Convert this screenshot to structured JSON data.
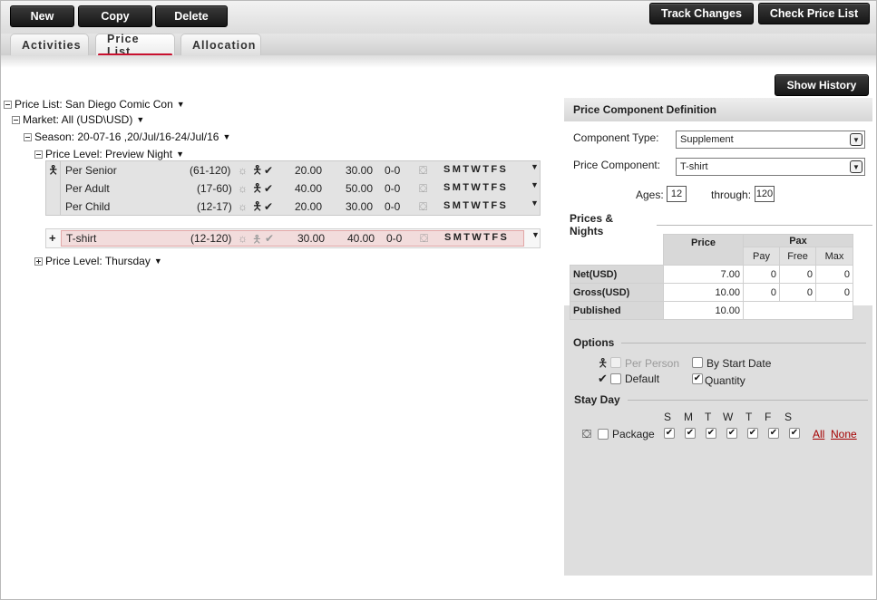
{
  "toolbar": {
    "new_label": "New",
    "copy_label": "Copy",
    "delete_label": "Delete",
    "track_changes_label": "Track Changes",
    "check_price_list_label": "Check Price List"
  },
  "tabs": [
    {
      "label": "Activities"
    },
    {
      "label": "Price List",
      "active": true
    },
    {
      "label": "Allocation"
    }
  ],
  "tree": {
    "price_list": "Price List: San Diego Comic Con",
    "market": "Market: All (USD\\USD)",
    "season": "Season: 20-07-16 ,20/Jul/16-24/Jul/16",
    "level1": "Price Level: Preview Night",
    "level2": "Price Level: Thursday",
    "rows": [
      {
        "name": "Per Senior",
        "ages": "(61-120)",
        "net": "20.00",
        "gross": "30.00",
        "range": "0-0",
        "days": "SMTWTFS"
      },
      {
        "name": "Per Adult",
        "ages": "(17-60)",
        "net": "40.00",
        "gross": "50.00",
        "range": "0-0",
        "days": "SMTWTFS"
      },
      {
        "name": "Per Child",
        "ages": "(12-17)",
        "net": "20.00",
        "gross": "30.00",
        "range": "0-0",
        "days": "SMTWTFS"
      }
    ],
    "supplement": {
      "expander": "+",
      "name": "T-shirt",
      "ages": "(12-120)",
      "net": "30.00",
      "gross": "40.00",
      "range": "0-0",
      "days": "SMTWTFS"
    }
  },
  "show_history_label": "Show History",
  "panel": {
    "title": "Price Component Definition",
    "component_type_label": "Component Type:",
    "component_type_value": "Supplement",
    "price_component_label": "Price Component:",
    "price_component_value": "T-shirt",
    "ages_label": "Ages:",
    "ages_from": "12",
    "through_label": "through:",
    "ages_to": "120",
    "prices_nights_title": "Prices & Nights",
    "table": {
      "price_header": "Price",
      "pax_header": "Pax",
      "pay_header": "Pay",
      "free_header": "Free",
      "max_header": "Max",
      "rows": [
        {
          "label": "Net(USD)",
          "price": "7.00",
          "pay": "0",
          "free": "0",
          "max": "0"
        },
        {
          "label": "Gross(USD)",
          "price": "10.00",
          "pay": "0",
          "free": "0",
          "max": "0"
        },
        {
          "label": "Published",
          "price": "10.00",
          "pay": "",
          "free": "",
          "max": ""
        }
      ]
    },
    "options_title": "Options",
    "per_person_label": "Per Person",
    "by_start_date_label": "By Start Date",
    "default_label": "Default",
    "quantity_label": "Quantity",
    "stay_day_title": "Stay Day",
    "stay_days": [
      "S",
      "M",
      "T",
      "W",
      "T",
      "F",
      "S"
    ],
    "package_label": "Package",
    "all_label": "All",
    "none_label": "None"
  },
  "colors": {
    "accent": "#c8102e",
    "link": "#a40000",
    "button": "#1e1e1e"
  }
}
